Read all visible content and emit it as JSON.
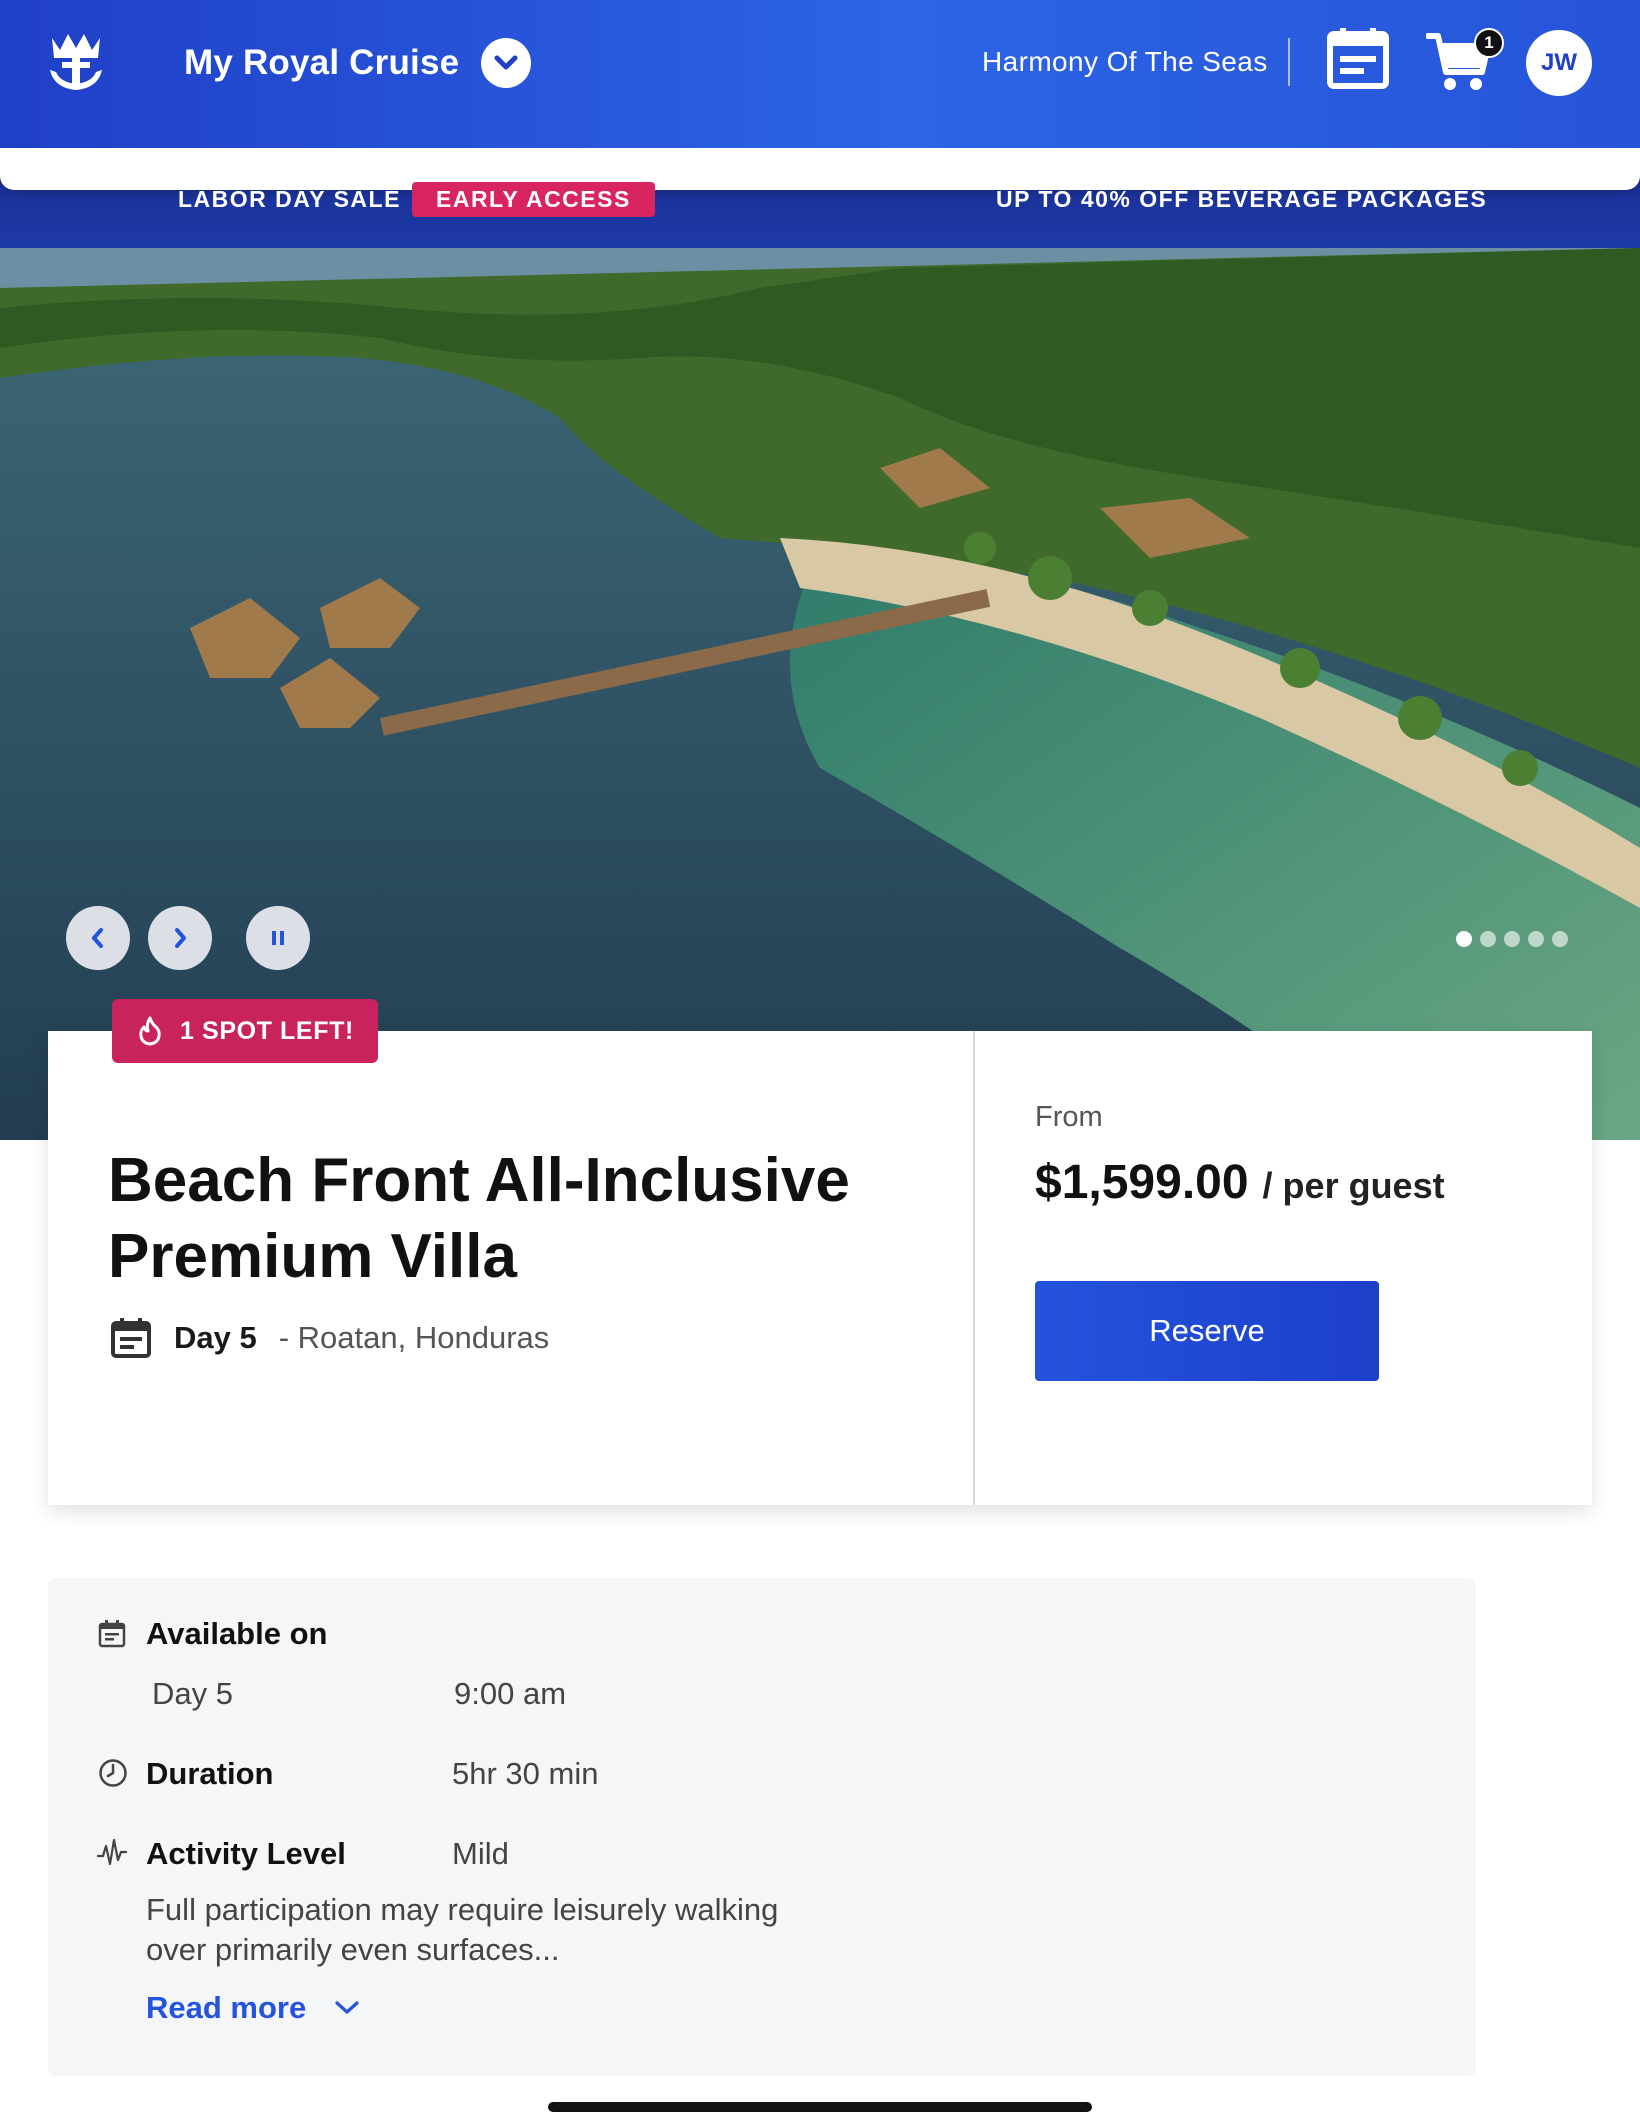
{
  "header": {
    "brand_title": "My Royal Cruise",
    "ship_name": "Harmony Of The Seas",
    "cart_count": "1",
    "avatar_initials": "JW",
    "logo_icon": "crown-anchor-icon",
    "calendar_icon": "calendar-icon",
    "cart_icon": "cart-icon"
  },
  "promo": {
    "left": "LABOR DAY SALE",
    "badge": "EARLY ACCESS",
    "right": "UP TO 40% OFF BEVERAGE PACKAGES"
  },
  "carousel": {
    "slide_count": 5,
    "active_index": 0
  },
  "card": {
    "badge": "1 SPOT LEFT!",
    "title": "Beach Front All-Inclusive Premium Villa",
    "day": "Day 5",
    "location": "- Roatan, Honduras",
    "from_label": "From",
    "price": "$1,599.00",
    "per": "/ per guest",
    "reserve_label": "Reserve"
  },
  "details": {
    "available_label": "Available on",
    "available_day": "Day 5",
    "available_time": "9:00 am",
    "duration_label": "Duration",
    "duration_value": "5hr 30 min",
    "activity_label": "Activity Level",
    "activity_value": "Mild",
    "activity_desc": "Full participation may require leisurely walking over primarily even surfaces...",
    "read_more": "Read more"
  },
  "colors": {
    "brand_blue": "#2453de",
    "badge_pink": "#c8235c",
    "promo_pink": "#d9255f"
  }
}
